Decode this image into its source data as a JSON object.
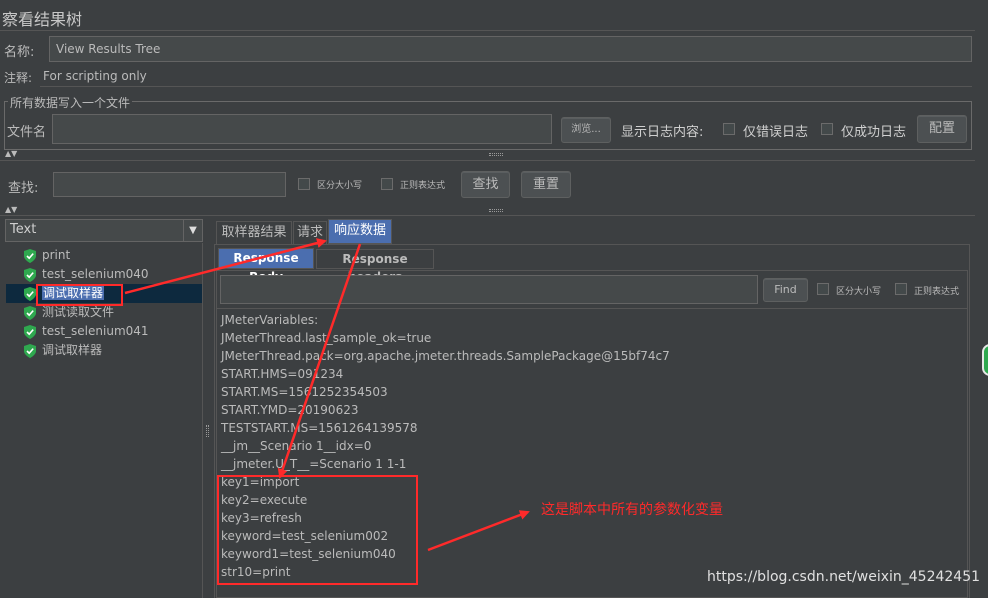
{
  "header": {
    "title": "察看结果树",
    "name_label": "名称:",
    "name_value": "View Results Tree",
    "comment_label": "注释:",
    "comment_value": "For scripting only"
  },
  "file_section": {
    "legend": "所有数据写入一个文件",
    "filename_label": "文件名",
    "filename_value": "",
    "browse_button": "浏览...",
    "log_label": "显示日志内容:",
    "errors_only": "仅错误日志",
    "success_only": "仅成功日志",
    "configure_button": "配置"
  },
  "search_bar": {
    "label": "查找:",
    "value": "",
    "case_sensitive": "区分大小写",
    "regex": "正则表达式",
    "find_button": "查找",
    "reset_button": "重置"
  },
  "renderer": {
    "selected": "Text"
  },
  "tree": {
    "items": [
      {
        "label": "print",
        "selected": false
      },
      {
        "label": "test_selenium040",
        "selected": false
      },
      {
        "label": "调试取样器",
        "selected": true
      },
      {
        "label": "测试读取文件",
        "selected": false
      },
      {
        "label": "test_selenium041",
        "selected": false
      },
      {
        "label": "调试取样器",
        "selected": false
      }
    ]
  },
  "tabs": {
    "main": [
      "取样器结果",
      "请求",
      "响应数据"
    ],
    "sub": [
      "Response Body",
      "Response headers"
    ]
  },
  "response_search": {
    "value": "",
    "find_button": "Find",
    "case_sensitive": "区分大小写",
    "regex": "正则表达式"
  },
  "response_lines": [
    "JMeterVariables:",
    "JMeterThread.last_sample_ok=true",
    "JMeterThread.pack=org.apache.jmeter.threads.SamplePackage@15bf74c7",
    "START.HMS=091234",
    "START.MS=1561252354503",
    "START.YMD=20190623",
    "TESTSTART.MS=1561264139578",
    "__jm__Scenario 1__idx=0",
    "__jmeter.U_T__=Scenario 1 1-1",
    "key1=import",
    "key2=execute",
    "key3=refresh",
    "keyword=test_selenium002",
    "keyword1=test_selenium040",
    "str10=print"
  ],
  "annotation": {
    "text": "这是脚本中所有的参数化变量",
    "color": "#ff2a2a"
  },
  "watermark": "https://blog.csdn.net/weixin_45242451",
  "colors": {
    "background": "#3c3f41",
    "selection": "#4b6eaf",
    "annotation_red": "#ff2a2a",
    "shield_green": "#2fa84f"
  }
}
